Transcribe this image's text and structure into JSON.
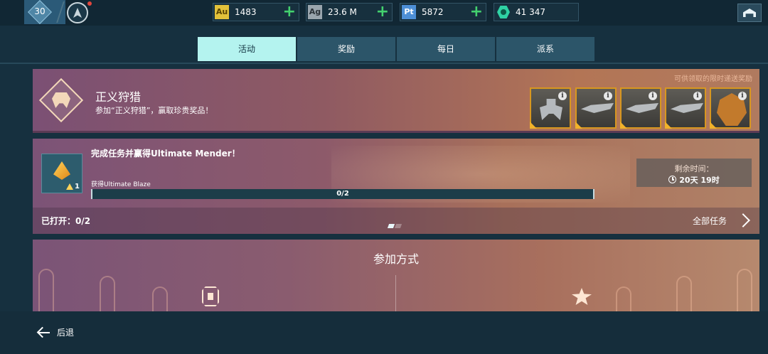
{
  "header": {
    "level": "30",
    "currencies": [
      {
        "icon": "Au",
        "value": "1483"
      },
      {
        "icon": "Ag",
        "value": "23.6 M"
      },
      {
        "icon": "Pt",
        "value": "5872"
      },
      {
        "icon": "gem-icon",
        "value": "41 347"
      }
    ],
    "plus_label": "+"
  },
  "tabs": [
    {
      "label": "活动",
      "active": true
    },
    {
      "label": "奖励",
      "active": false
    },
    {
      "label": "每日",
      "active": false
    },
    {
      "label": "派系",
      "active": false
    }
  ],
  "event": {
    "title": "正义狩猎",
    "description": "参加“正义狩猎”，赢取珍贵奖品！",
    "reward_caption": "可供领取的限时递送奖励",
    "rewards": [
      {
        "kind": "robot",
        "info": "i"
      },
      {
        "kind": "weapon",
        "info": "i"
      },
      {
        "kind": "weapon",
        "info": "i"
      },
      {
        "kind": "weapon",
        "info": "i"
      },
      {
        "kind": "pilot",
        "info": "i"
      }
    ]
  },
  "task": {
    "title": "完成任务并赢得Ultimate Mender！",
    "icon_count": "1",
    "subtitle": "获得Ultimate Blaze",
    "progress_text": "0/2",
    "progress_fraction": 0,
    "timer_label": "剩余时间：",
    "timer_value": "20天 19时",
    "opened_label": "已打开：0/2",
    "all_tasks_label": "全部任务"
  },
  "join": {
    "title": "参加方式"
  },
  "footer": {
    "back_label": "后退"
  },
  "colors": {
    "active_tab": "#b4f3ef",
    "plus": "#43d16e",
    "reward_border": "#d8971f"
  }
}
